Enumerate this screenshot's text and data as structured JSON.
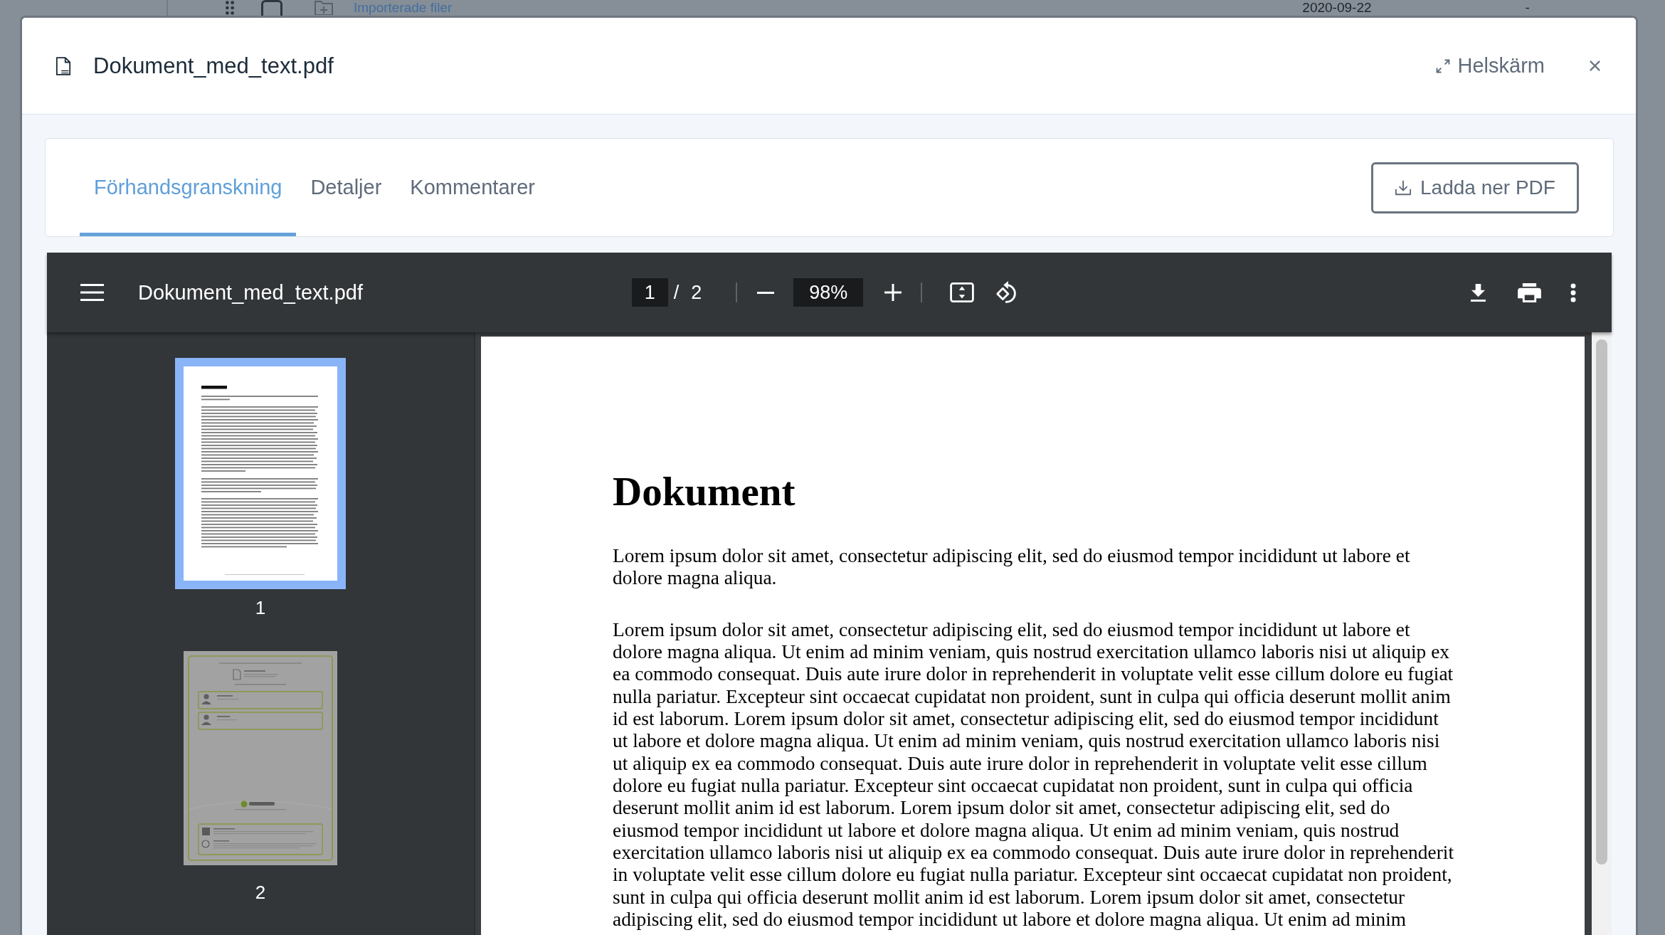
{
  "background_row": {
    "checked": false,
    "folder_label": "Importerade filer",
    "date": "2020-09-22",
    "column_3": "-"
  },
  "dialog": {
    "title": "Dokument_med_text.pdf",
    "fullscreen_label": "Helskärm"
  },
  "tabs": [
    {
      "label": "Förhandsgranskning",
      "selected": true
    },
    {
      "label": "Detaljer",
      "selected": false
    },
    {
      "label": "Kommentarer",
      "selected": false
    }
  ],
  "download_button": {
    "label": "Ladda ner PDF"
  },
  "viewer": {
    "title": "Dokument_med_text.pdf",
    "page": "1",
    "page_separator": "/",
    "page_count": "2",
    "zoom": "98%"
  },
  "thumbnails": [
    {
      "kind": "text",
      "label": "1",
      "selected": true
    },
    {
      "kind": "signatures",
      "label": "2",
      "selected": false
    }
  ],
  "document": {
    "heading": "Dokument",
    "paragraphs": [
      "Lorem ipsum dolor sit amet, consectetur adipiscing elit, sed do eiusmod tempor incididunt ut labore et\ndolore magna aliqua.",
      "Lorem ipsum dolor sit amet, consectetur adipiscing elit, sed do eiusmod tempor incididunt ut labore et\ndolore magna aliqua. Ut enim ad minim veniam, quis nostrud exercitation ullamco laboris nisi ut aliquip ex\nea commodo consequat. Duis aute irure dolor in reprehenderit in voluptate velit esse cillum dolore eu fugiat\nnulla pariatur. Excepteur sint occaecat cupidatat non proident, sunt in culpa qui officia deserunt mollit anim\nid est laborum. Lorem ipsum dolor sit amet, consectetur adipiscing elit, sed do eiusmod tempor incididunt\nut labore et dolore magna aliqua. Ut enim ad minim veniam, quis nostrud exercitation ullamco laboris nisi\nut aliquip ex ea commodo consequat. Duis aute irure dolor in reprehenderit in voluptate velit esse cillum\ndolore eu fugiat nulla pariatur. Excepteur sint occaecat cupidatat non proident, sunt in culpa qui officia\ndeserunt mollit anim id est laborum. Lorem ipsum dolor sit amet, consectetur adipiscing elit, sed do\neiusmod tempor incididunt ut labore et dolore magna aliqua. Ut enim ad minim veniam, quis nostrud\nexercitation ullamco laboris nisi ut aliquip ex ea commodo consequat. Duis aute irure dolor in reprehenderit\nin voluptate velit esse cillum dolore eu fugiat nulla pariatur. Excepteur sint occaecat cupidatat non proident,\nsunt in culpa qui officia deserunt mollit anim id est laborum. Lorem ipsum dolor sit amet, consectetur\nadipiscing elit, sed do eiusmod tempor incididunt ut labore et dolore magna aliqua. Ut enim ad minim"
    ]
  }
}
